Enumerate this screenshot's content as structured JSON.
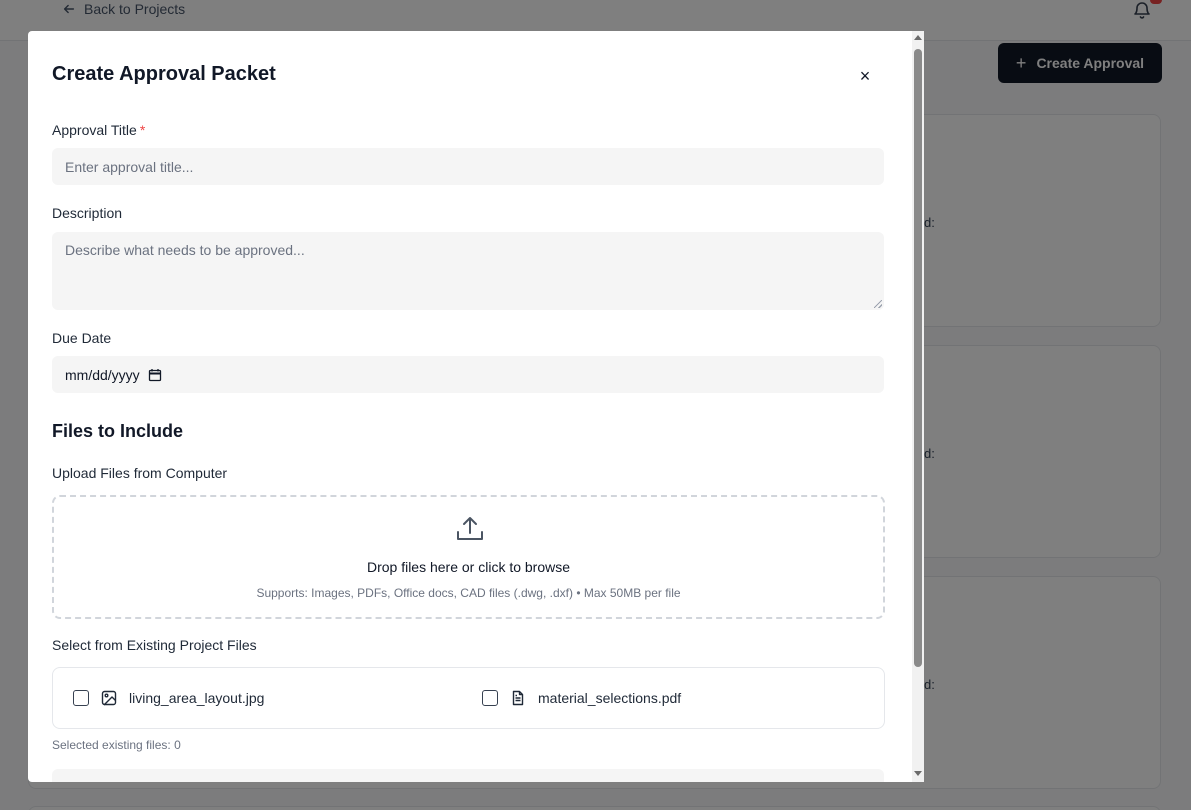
{
  "background": {
    "back_link": "Back to Projects",
    "create_button": "Create Approval",
    "card_fragment": "d:"
  },
  "modal": {
    "title": "Create Approval Packet",
    "close_symbol": "×",
    "approval_title": {
      "label": "Approval Title",
      "required_mark": "*",
      "placeholder": "Enter approval title..."
    },
    "description": {
      "label": "Description",
      "placeholder": "Describe what needs to be approved..."
    },
    "due_date": {
      "label": "Due Date",
      "value": "mm/dd/yyyy"
    },
    "files_section_title": "Files to Include",
    "upload": {
      "label": "Upload Files from Computer",
      "main_text": "Drop files here or click to browse",
      "sub_text": "Supports: Images, PDFs, Office docs, CAD files (.dwg, .dxf) • Max 50MB per file"
    },
    "existing": {
      "label": "Select from Existing Project Files",
      "files": [
        {
          "name": "living_area_layout.jpg",
          "icon": "image-icon",
          "checked": false
        },
        {
          "name": "material_selections.pdf",
          "icon": "file-text-icon",
          "checked": false
        }
      ],
      "selected_text": "Selected existing files: 0"
    }
  },
  "colors": {
    "primary_button": "#111827",
    "required": "#ef4444",
    "input_bg": "#f5f5f5",
    "overlay": "rgba(0,0,0,0.5)"
  }
}
